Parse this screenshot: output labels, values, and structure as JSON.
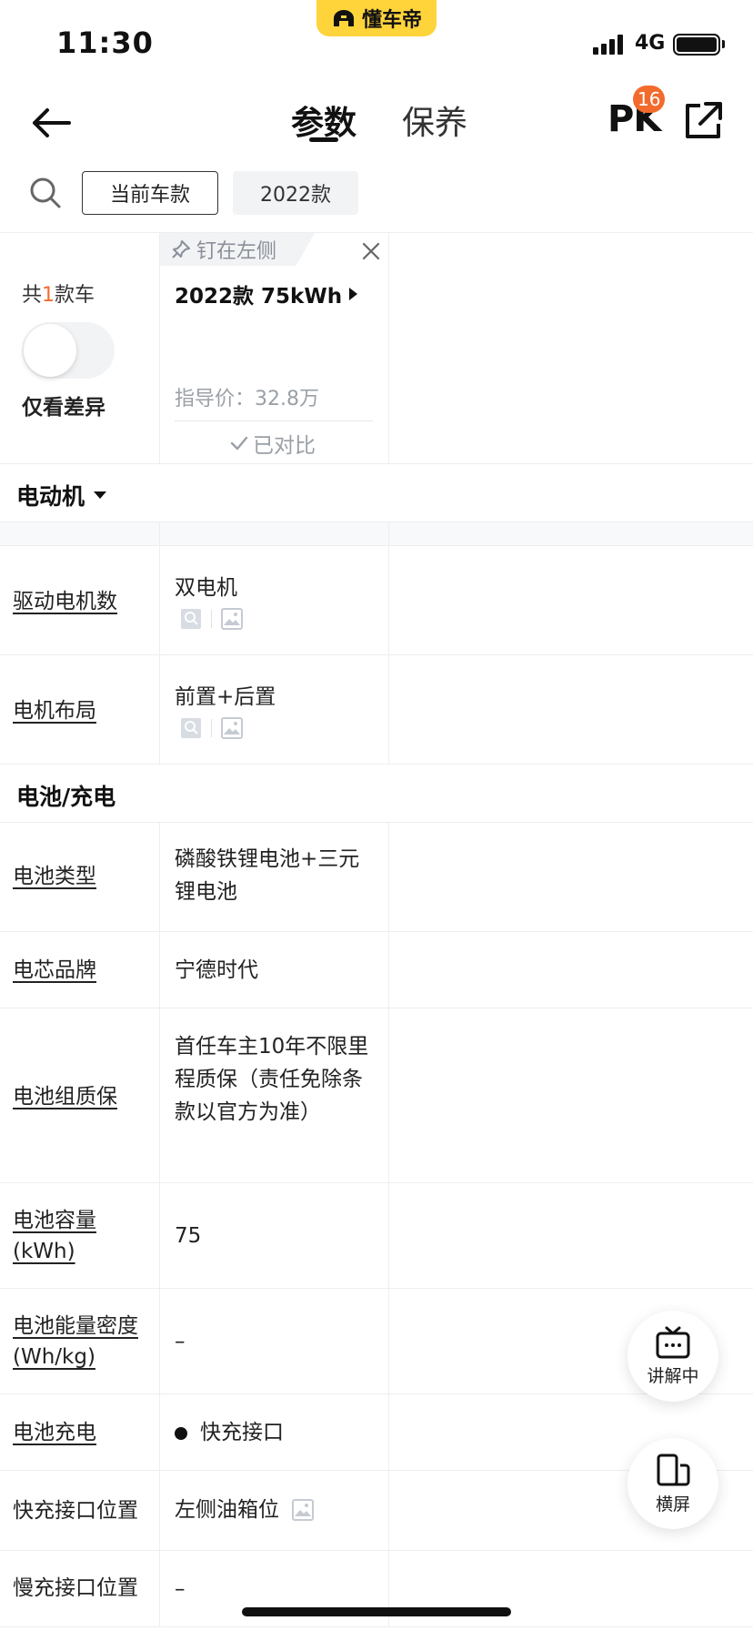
{
  "status_bar": {
    "time": "11:30",
    "network": "4G",
    "app_name": "懂车帝"
  },
  "nav": {
    "tab_params": "参数",
    "tab_maintenance": "保养",
    "pk_label": "PK",
    "pk_badge": "16"
  },
  "filters": {
    "current_model": "当前车款",
    "year": "2022款"
  },
  "compare": {
    "count_prefix": "共",
    "count": "1",
    "count_suffix": "款车",
    "diff_toggle_label": "仅看差异",
    "pin_label": "钉在左侧",
    "model_name": "2022款 75kWh",
    "price": "指导价：32.8万",
    "compared_label": "已对比"
  },
  "sections": {
    "motor": {
      "title": "电动机"
    },
    "battery": {
      "title": "电池/充电"
    }
  },
  "rows": {
    "drive_motors": {
      "label": "驱动电机数",
      "value": "双电机"
    },
    "motor_layout": {
      "label": "电机布局",
      "value": "前置+后置"
    },
    "battery_type": {
      "label": "电池类型",
      "value": "磷酸铁锂电池+三元锂电池"
    },
    "cell_brand": {
      "label": "电芯品牌",
      "value": "宁德时代"
    },
    "battery_warranty": {
      "label": "电池组质保",
      "value": "首任车主10年不限里程质保（责任免除条款以官方为准）"
    },
    "battery_capacity": {
      "label": "电池容量(kWh)",
      "value": "75"
    },
    "energy_density": {
      "label": "电池能量密度(Wh/kg)",
      "value": "–"
    },
    "charging": {
      "label": "电池充电",
      "value": "快充接口"
    },
    "fast_port_pos": {
      "label": "快充接口位置",
      "value": "左侧油箱位"
    },
    "slow_port_pos": {
      "label": "慢充接口位置",
      "value": "–"
    }
  },
  "floating": {
    "explain": "讲解中",
    "landscape": "横屏"
  },
  "colors": {
    "brand_yellow": "#ffd43b",
    "accent_orange": "#f26b2d",
    "muted_gray": "#9aa0a6"
  }
}
